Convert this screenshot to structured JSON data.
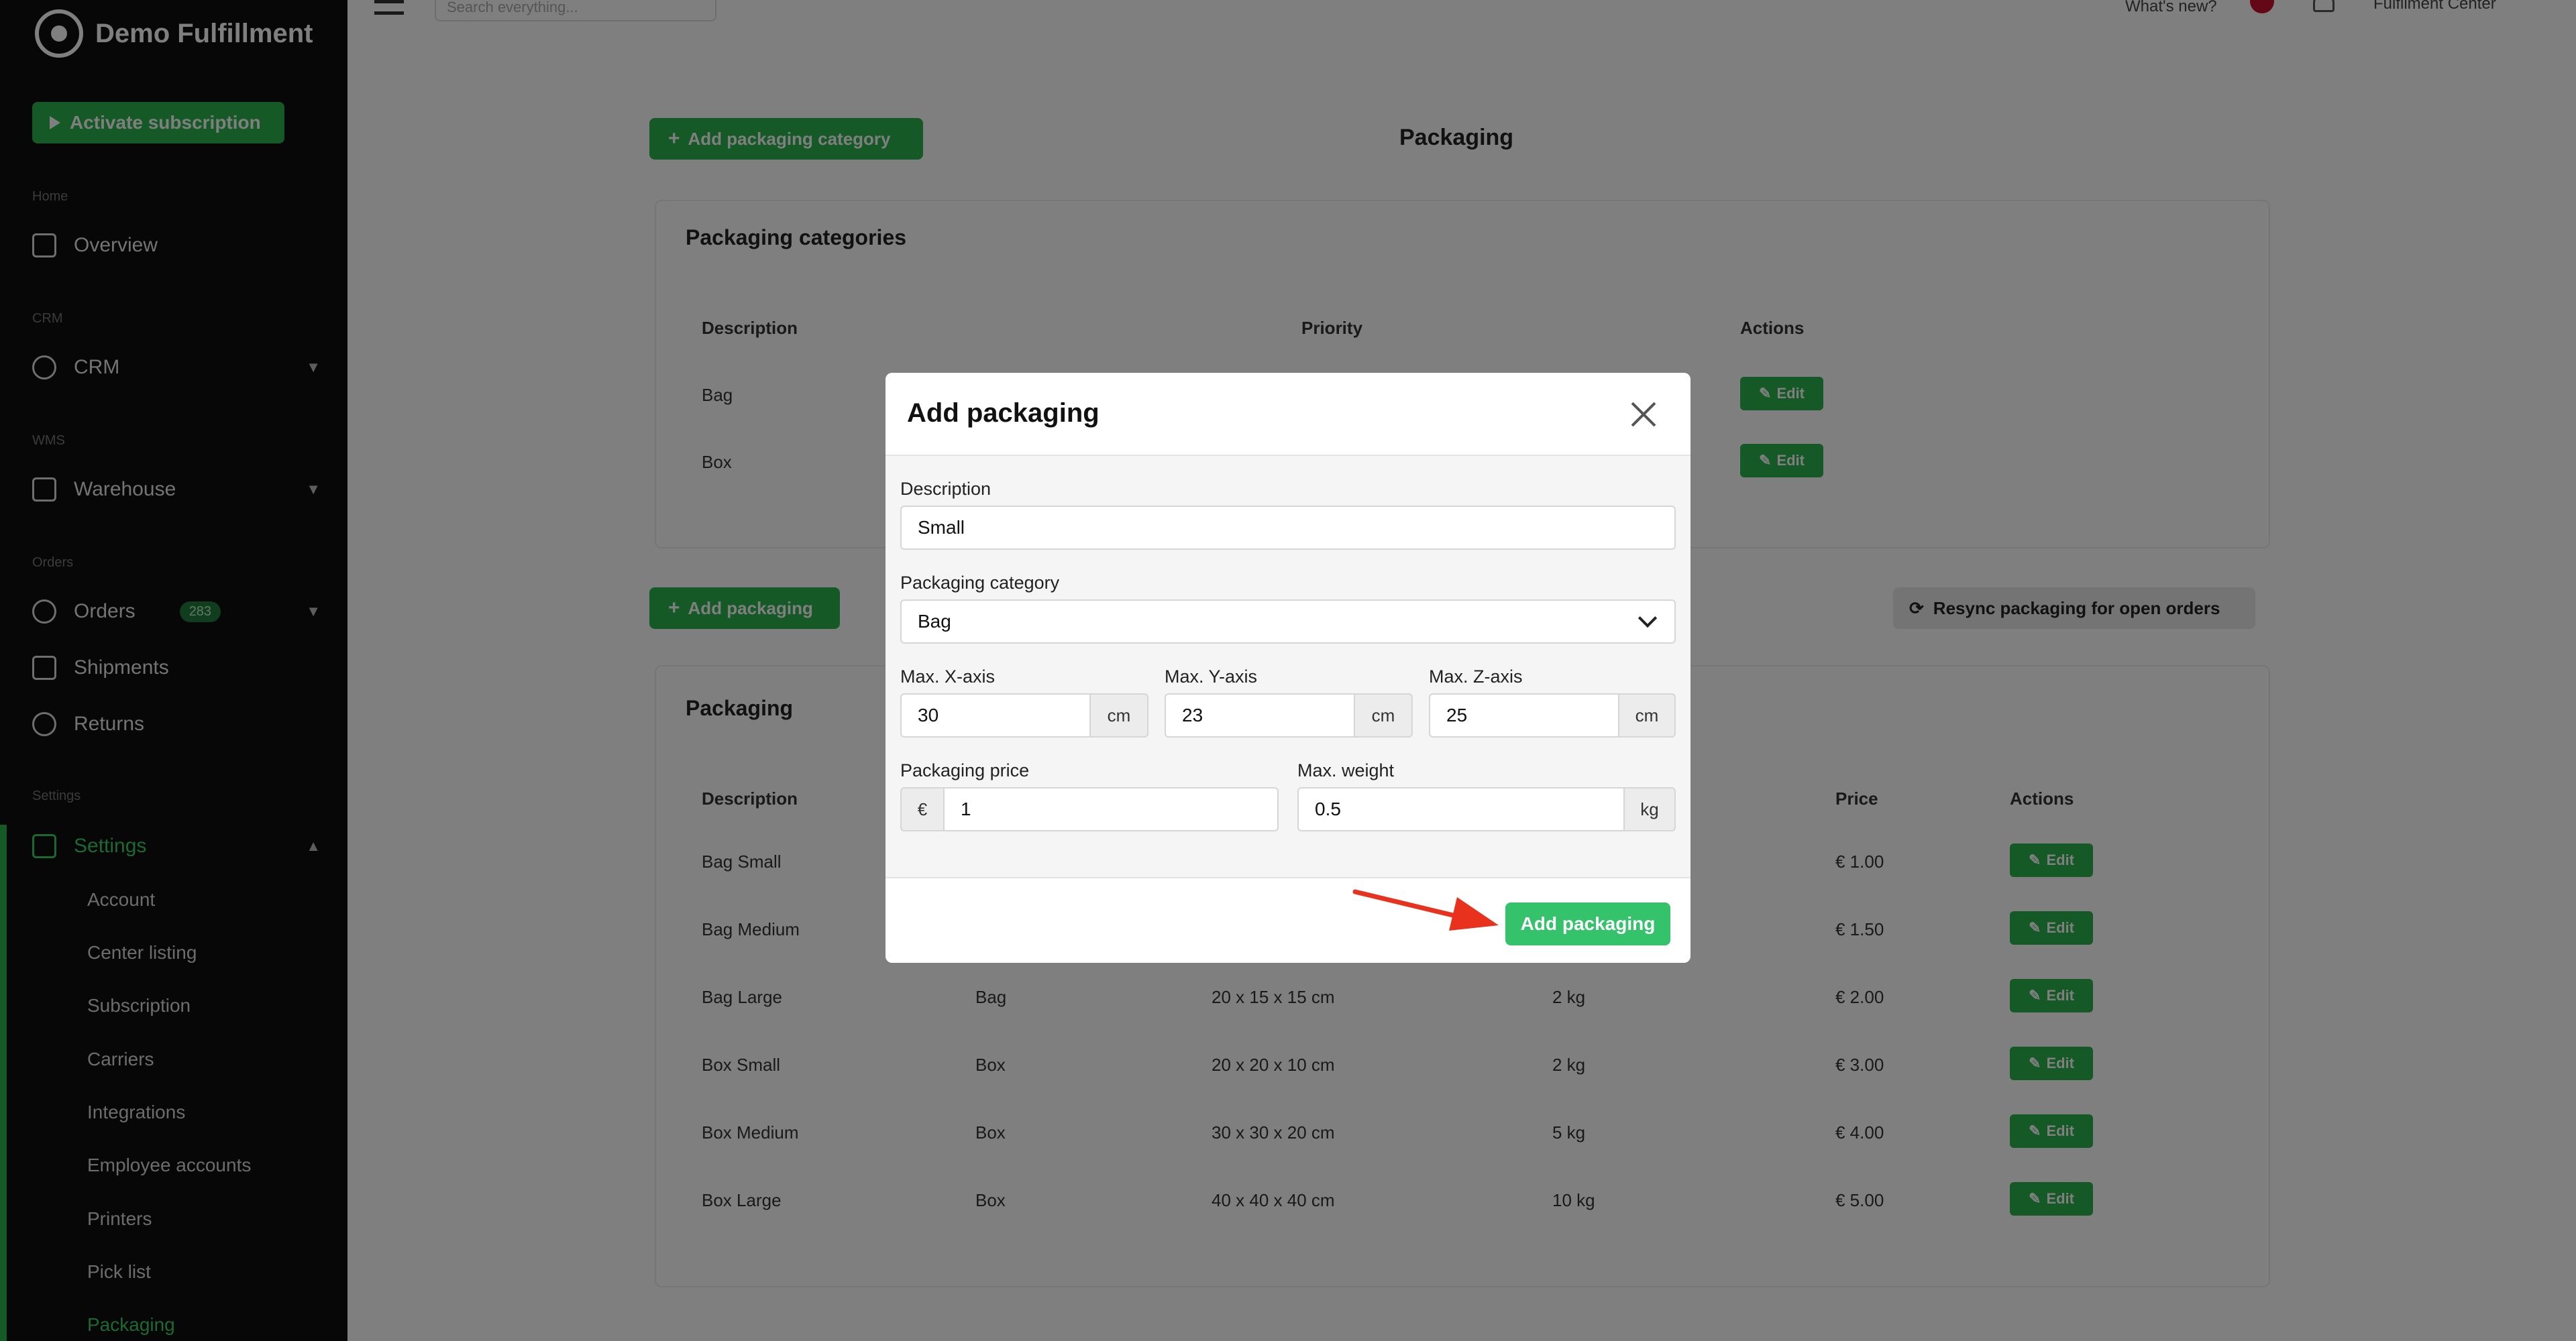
{
  "sidebar": {
    "brand": "Demo Fulfillment",
    "activate": "Activate subscription",
    "sections": {
      "home": "Home",
      "crm": "CRM",
      "wms": "WMS",
      "orders": "Orders",
      "settings": "Settings"
    },
    "items": {
      "overview": "Overview",
      "crm": "CRM",
      "warehouse": "Warehouse",
      "orders": "Orders",
      "orders_count": "283",
      "shipments": "Shipments",
      "returns": "Returns",
      "settings": "Settings"
    },
    "sub_items": [
      "Account",
      "Center listing",
      "Subscription",
      "Carriers",
      "Integrations",
      "Employee accounts",
      "Printers",
      "Pick list",
      "Packaging"
    ]
  },
  "topbar": {
    "search_placeholder": "Search everything...",
    "whats_new": "What's new?",
    "center": "Fulfilment Center"
  },
  "page": {
    "title": "Packaging",
    "add_category": "Add packaging category",
    "add_packaging": "Add packaging",
    "resync": "Resync packaging for open orders",
    "edit": "Edit",
    "categories_card": {
      "title": "Packaging categories",
      "headers": [
        "Description",
        "Priority",
        "Actions"
      ],
      "rows": [
        [
          "Bag"
        ],
        [
          "Box"
        ]
      ]
    },
    "packaging_card": {
      "title": "Packaging",
      "headers": [
        "Description",
        "Price",
        "Actions"
      ],
      "rows": [
        [
          "Bag Small",
          "",
          "",
          "",
          "€ 1.00"
        ],
        [
          "Bag Medium",
          "",
          "",
          "",
          "€ 1.50"
        ],
        [
          "Bag Large",
          "Bag",
          "20 x 15 x 15 cm",
          "2 kg",
          "€ 2.00"
        ],
        [
          "Box Small",
          "Box",
          "20 x 20 x 10 cm",
          "2 kg",
          "€ 3.00"
        ],
        [
          "Box Medium",
          "Box",
          "30 x 30 x 20 cm",
          "5 kg",
          "€ 4.00"
        ],
        [
          "Box Large",
          "Box",
          "40 x 40 x 40 cm",
          "10 kg",
          "€ 5.00"
        ]
      ]
    }
  },
  "modal": {
    "title": "Add packaging",
    "description_label": "Description",
    "description_value": "Small",
    "category_label": "Packaging category",
    "category_value": "Bag",
    "x_label": "Max. X-axis",
    "x_value": "30",
    "y_label": "Max. Y-axis",
    "y_value": "23",
    "z_label": "Max. Z-axis",
    "z_value": "25",
    "unit_cm": "cm",
    "price_label": "Packaging price",
    "currency": "€",
    "price_value": "1",
    "weight_label": "Max. weight",
    "weight_value": "0.5",
    "unit_kg": "kg",
    "submit": "Add packaging"
  },
  "colors": {
    "accent": "#34c26b",
    "arrow": "#e8321e"
  }
}
